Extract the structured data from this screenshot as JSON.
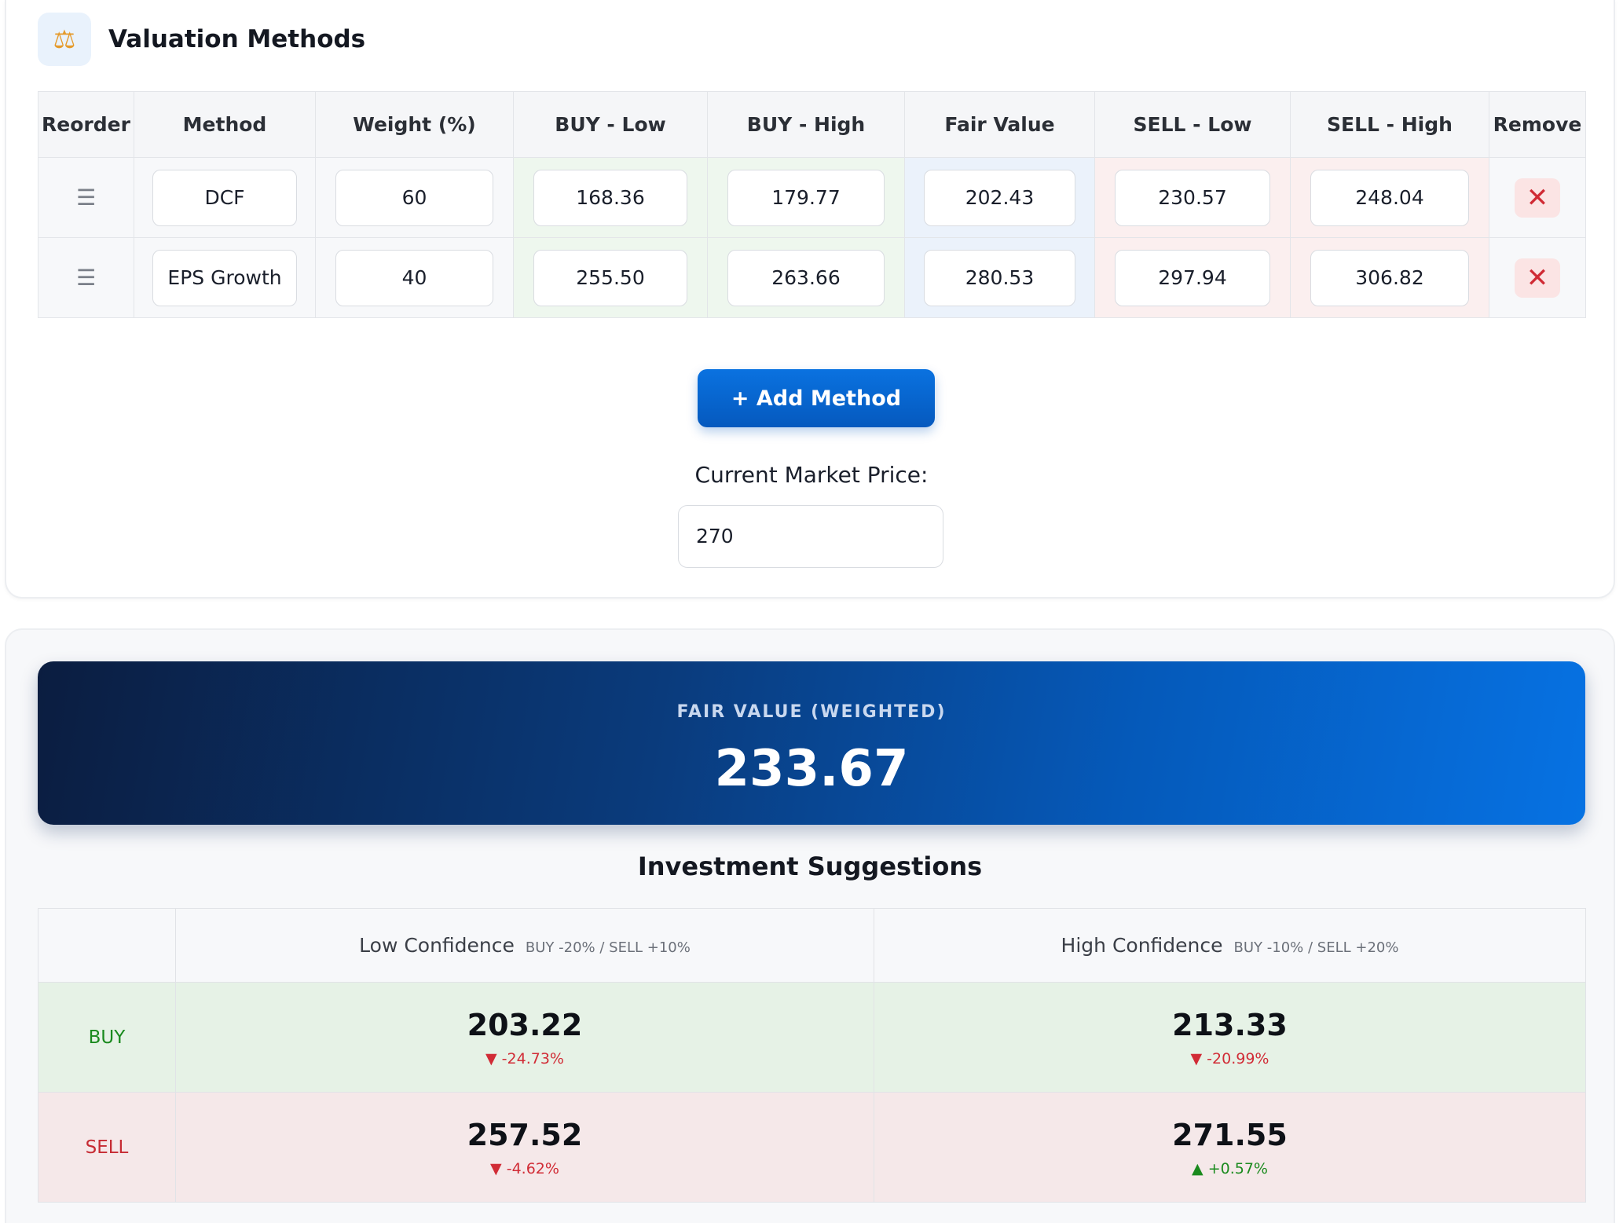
{
  "header": {
    "icon": "scale-icon",
    "title": "Valuation Methods"
  },
  "methods_table": {
    "columns": [
      "Reorder",
      "Method",
      "Weight (%)",
      "BUY - Low",
      "BUY - High",
      "Fair Value",
      "SELL - Low",
      "SELL - High",
      "Remove"
    ],
    "rows": [
      {
        "method": "DCF",
        "weight": "60",
        "buy_low": "168.36",
        "buy_high": "179.77",
        "fair_value": "202.43",
        "sell_low": "230.57",
        "sell_high": "248.04"
      },
      {
        "method": "EPS Growth",
        "weight": "40",
        "buy_low": "255.50",
        "buy_high": "263.66",
        "fair_value": "280.53",
        "sell_low": "297.94",
        "sell_high": "306.82"
      }
    ]
  },
  "add_method_label": "+ Add Method",
  "market_price": {
    "label": "Current Market Price:",
    "value": "270"
  },
  "fair_value_banner": {
    "label": "FAIR VALUE (WEIGHTED)",
    "value": "233.67"
  },
  "suggestions": {
    "title": "Investment Suggestions",
    "low_confidence": {
      "label": "Low Confidence",
      "sub": "BUY -20% / SELL +10%"
    },
    "high_confidence": {
      "label": "High Confidence",
      "sub": "BUY -10% / SELL +20%"
    },
    "buy": {
      "label": "BUY",
      "low": {
        "value": "203.22",
        "delta": "-24.73%",
        "direction": "down"
      },
      "high": {
        "value": "213.33",
        "delta": "-20.99%",
        "direction": "down"
      }
    },
    "sell": {
      "label": "SELL",
      "low": {
        "value": "257.52",
        "delta": "-4.62%",
        "direction": "down"
      },
      "high": {
        "value": "271.55",
        "delta": "+0.57%",
        "direction": "up"
      }
    }
  },
  "colors": {
    "accent": "#0767d6",
    "buy_text": "#1a8a1e",
    "sell_text": "#c62b33",
    "buy_bg": "#e6f2e6",
    "sell_bg": "#f5e8e9"
  }
}
